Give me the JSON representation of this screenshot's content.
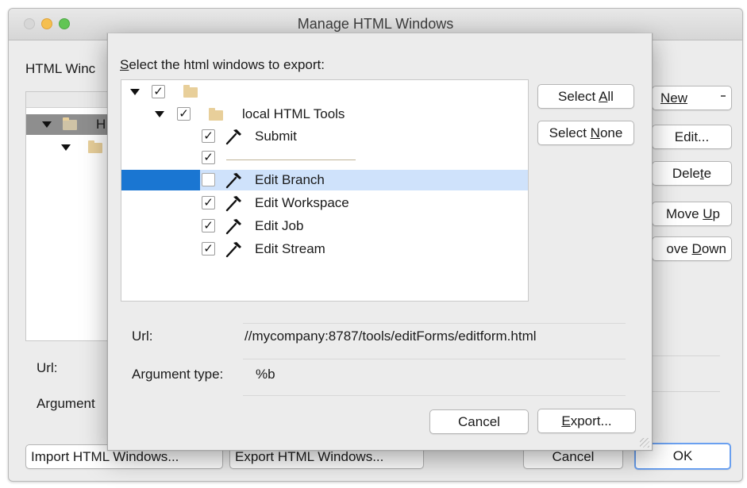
{
  "window": {
    "title": "Manage HTML Windows",
    "html_windows_label": "HTML Winc",
    "tree_root_label": "H",
    "url_label": "Url:",
    "argument_label": "Argument",
    "buttons": {
      "new": "New",
      "edit": "Edit...",
      "delete_pre": "Dele",
      "delete_u": "t",
      "delete_post": "e",
      "move_up_pre": "Move ",
      "move_up_u": "U",
      "move_up_post": "p",
      "move_down_pre": "ove ",
      "move_down_u": "D",
      "move_down_post": "own",
      "import": "Import HTML Windows...",
      "export": "Export HTML Windows...",
      "cancel": "Cancel",
      "ok": "OK"
    }
  },
  "dialog": {
    "heading_u": "S",
    "heading_rest": "elect the html windows to export:",
    "tree": {
      "rows": [
        {
          "label": "",
          "checked": true,
          "type": "folder",
          "expanded": true
        },
        {
          "label": "local HTML Tools",
          "checked": true,
          "type": "folder",
          "expanded": true
        },
        {
          "label": "Submit",
          "checked": true,
          "type": "tool"
        },
        {
          "label": "",
          "checked": true,
          "type": "separator"
        },
        {
          "label": "Edit Branch",
          "checked": false,
          "type": "tool",
          "selected": true
        },
        {
          "label": "Edit Workspace",
          "checked": true,
          "type": "tool"
        },
        {
          "label": "Edit Job",
          "checked": true,
          "type": "tool"
        },
        {
          "label": "Edit Stream",
          "checked": true,
          "type": "tool"
        }
      ]
    },
    "select_all_pre": "Select ",
    "select_all_u": "A",
    "select_all_post": "ll",
    "select_none_pre": "Select ",
    "select_none_u": "N",
    "select_none_post": "one",
    "url_label": "Url:",
    "url_value": "//mycompany:8787/tools/editForms/editform.html",
    "argument_type_label": "Argument type:",
    "argument_type_value": "%b",
    "cancel": "Cancel",
    "export_u": "E",
    "export_rest": "xport..."
  },
  "colors": {
    "selection_row": "#cfe2fb",
    "selection_accent": "#1a76d2",
    "folder": "#e8cf9a",
    "ok_focus_ring": "#6aa0f0"
  },
  "icons": {
    "checkbox": "✓",
    "tool": "hammer-icon",
    "folder": "folder-icon"
  }
}
